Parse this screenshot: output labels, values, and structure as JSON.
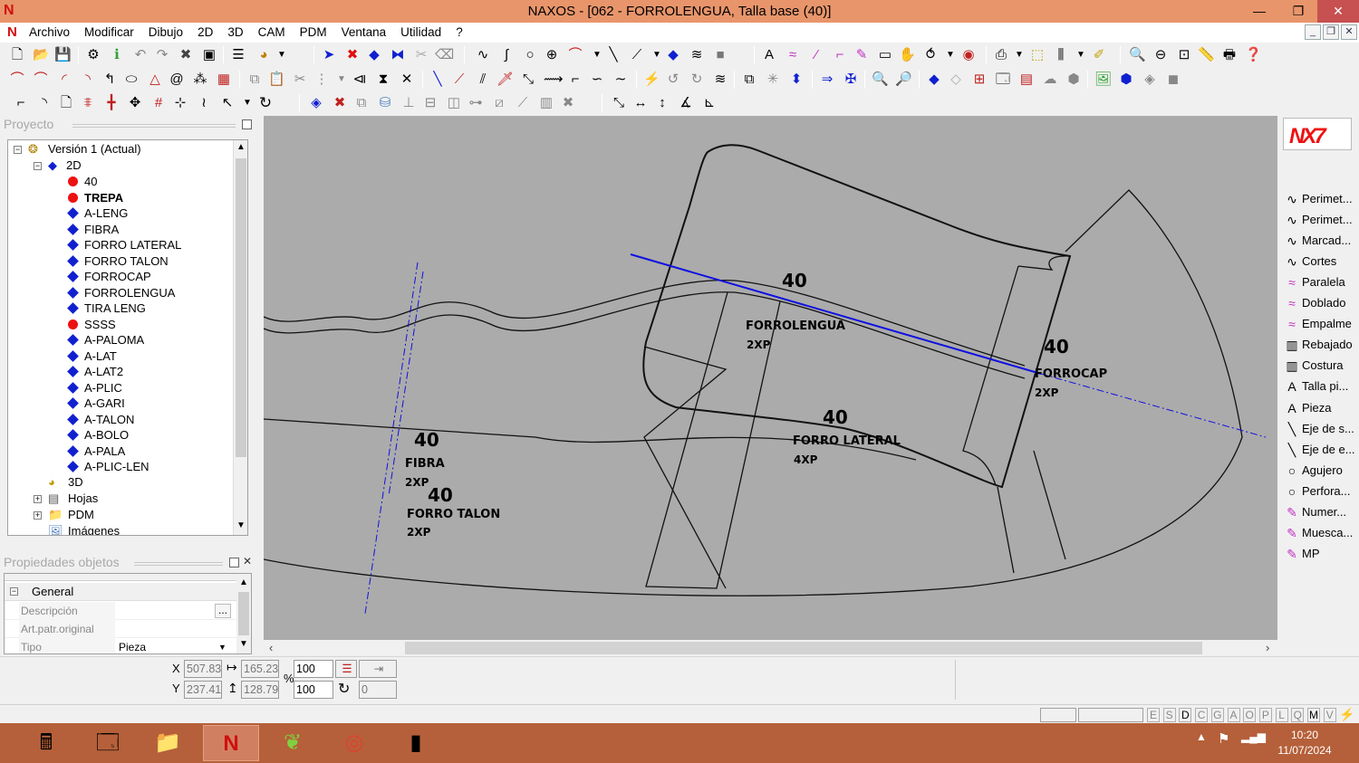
{
  "window": {
    "title": "NAXOS - [062 - FORROLENGUA, Talla base (40)]",
    "minimize": "—",
    "maximize": "❐",
    "close": "✕"
  },
  "menu": [
    "Archivo",
    "Modificar",
    "Dibujo",
    "2D",
    "3D",
    "CAM",
    "PDM",
    "Ventana",
    "Utilidad",
    "?"
  ],
  "project_panel": {
    "title": "Proyecto",
    "root": "Versión 1 (Actual)",
    "node_2d": "2D",
    "items": [
      {
        "label": "40",
        "marker": "red",
        "bold": false
      },
      {
        "label": "TREPA",
        "marker": "red",
        "bold": true
      },
      {
        "label": "A-LENG",
        "marker": "blue",
        "bold": false
      },
      {
        "label": "FIBRA",
        "marker": "blue",
        "bold": false
      },
      {
        "label": "FORRO LATERAL",
        "marker": "blue",
        "bold": false
      },
      {
        "label": "FORRO TALON",
        "marker": "blue",
        "bold": false
      },
      {
        "label": "FORROCAP",
        "marker": "blue",
        "bold": false
      },
      {
        "label": "FORROLENGUA",
        "marker": "blue",
        "bold": false
      },
      {
        "label": "TIRA LENG",
        "marker": "blue",
        "bold": false
      },
      {
        "label": "SSSS",
        "marker": "red",
        "bold": false
      },
      {
        "label": "A-PALOMA",
        "marker": "blue",
        "bold": false
      },
      {
        "label": "A-LAT",
        "marker": "blue",
        "bold": false
      },
      {
        "label": "A-LAT2",
        "marker": "blue",
        "bold": false
      },
      {
        "label": "A-PLIC",
        "marker": "blue",
        "bold": false
      },
      {
        "label": "A-GARI",
        "marker": "blue",
        "bold": false
      },
      {
        "label": "A-TALON",
        "marker": "blue",
        "bold": false
      },
      {
        "label": "A-BOLO",
        "marker": "blue",
        "bold": false
      },
      {
        "label": "A-PALA",
        "marker": "blue",
        "bold": false
      },
      {
        "label": "A-PLIC-LEN",
        "marker": "blue",
        "bold": false
      }
    ],
    "node_3d": "3D",
    "node_hojas": "Hojas",
    "node_pdm": "PDM",
    "node_imagenes": "Imágenes"
  },
  "properties_panel": {
    "title": "Propiedades objetos",
    "group": "General",
    "rows": [
      {
        "key": "Descripción",
        "value": "",
        "button": "..."
      },
      {
        "key": "Art.patr.original",
        "value": ""
      },
      {
        "key": "Tipo",
        "value": "Pieza"
      }
    ]
  },
  "canvas": {
    "labels": [
      {
        "size": "40",
        "name": "FORROLENGUA",
        "qty": "2XP"
      },
      {
        "size": "40",
        "name": "FORROCAP",
        "qty": "2XP"
      },
      {
        "size": "40",
        "name": "FORRO LATERAL",
        "qty": "4XP"
      },
      {
        "size": "40",
        "name": "FIBRA",
        "qty": "2XP"
      },
      {
        "size": "40",
        "name": "FORRO TALON",
        "qty": "2XP"
      }
    ]
  },
  "right_tools": [
    {
      "label": "Perimet...",
      "icon": "curve-icon"
    },
    {
      "label": "Perimet...",
      "icon": "curve-icon"
    },
    {
      "label": "Marcad...",
      "icon": "curve-icon"
    },
    {
      "label": "Cortes",
      "icon": "curve-icon"
    },
    {
      "label": "Paralela",
      "icon": "parallel-icon"
    },
    {
      "label": "Doblado",
      "icon": "fold-icon"
    },
    {
      "label": "Empalme",
      "icon": "splice-icon"
    },
    {
      "label": "Rebajado",
      "icon": "skive-icon"
    },
    {
      "label": "Costura",
      "icon": "seam-icon"
    },
    {
      "label": "Talla pi...",
      "icon": "text-icon"
    },
    {
      "label": "Pieza",
      "icon": "text-icon"
    },
    {
      "label": "Eje de s...",
      "icon": "axis-icon"
    },
    {
      "label": "Eje de e...",
      "icon": "axis-icon"
    },
    {
      "label": "Agujero",
      "icon": "hole-icon"
    },
    {
      "label": "Perfora...",
      "icon": "hole-icon"
    },
    {
      "label": "Numer...",
      "icon": "pen-icon"
    },
    {
      "label": "Muesca...",
      "icon": "pen-icon"
    },
    {
      "label": "MP",
      "icon": "pen-icon"
    }
  ],
  "coords": {
    "x_label": "X",
    "y_label": "Y",
    "x": "507.83",
    "y": "237.41",
    "width": "165.23",
    "height": "128.79",
    "scale_x": "100",
    "scale_y": "100",
    "percent": "%",
    "angle": "0"
  },
  "status_modes": [
    "E",
    "S",
    "D",
    "C",
    "G",
    "A",
    "O",
    "P",
    "L",
    "Q",
    "M",
    "V"
  ],
  "taskbar": {
    "time": "10:20",
    "date": "11/07/2024"
  },
  "colors": {
    "titlebar": "#e8956b",
    "canvas": "#ababab",
    "taskbar": "#b5603a",
    "blue_line": "#1010e0"
  }
}
